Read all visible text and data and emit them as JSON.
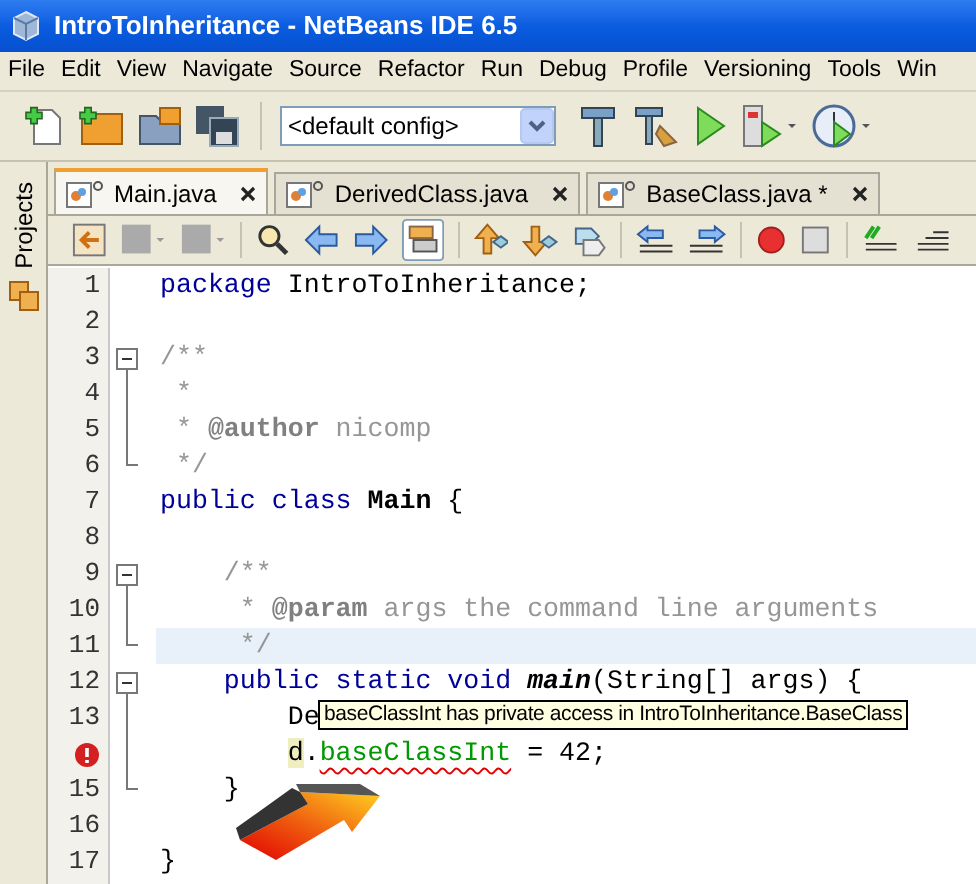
{
  "window": {
    "title": "IntroToInheritance - NetBeans IDE 6.5"
  },
  "menu": [
    "File",
    "Edit",
    "View",
    "Navigate",
    "Source",
    "Refactor",
    "Run",
    "Debug",
    "Profile",
    "Versioning",
    "Tools",
    "Win"
  ],
  "toolbar": {
    "config": "<default config>"
  },
  "sidebar": {
    "label": "Projects"
  },
  "tabs": [
    {
      "label": "Main.java",
      "selected": true
    },
    {
      "label": "DerivedClass.java",
      "selected": false
    },
    {
      "label": "BaseClass.java *",
      "selected": false
    }
  ],
  "editor": {
    "lines": [
      {
        "number": "1",
        "tokens": [
          {
            "text": "package",
            "kind": "keyword"
          },
          {
            "text": " IntroToInheritance;",
            "kind": "plain"
          }
        ]
      },
      {
        "number": "2"
      },
      {
        "number": "3",
        "fold_toggle": true,
        "tokens": [
          {
            "text": "/**",
            "kind": "comment"
          }
        ]
      },
      {
        "number": "4",
        "fold_line": true,
        "tokens": [
          {
            "text": " *",
            "kind": "comment"
          }
        ]
      },
      {
        "number": "5",
        "fold_line": true,
        "tokens": [
          {
            "text": " * ",
            "kind": "comment"
          },
          {
            "text": "@author",
            "kind": "doc-tag"
          },
          {
            "text": " nicomp",
            "kind": "comment"
          }
        ]
      },
      {
        "number": "6",
        "fold_end": true,
        "tokens": [
          {
            "text": " */",
            "kind": "comment"
          }
        ]
      },
      {
        "number": "7",
        "tokens": [
          {
            "text": "public",
            "kind": "keyword"
          },
          {
            "text": " class",
            "kind": "keyword"
          },
          {
            "text": " Main",
            "kind": "class-name"
          },
          {
            "text": " {",
            "kind": "plain"
          }
        ]
      },
      {
        "number": "8"
      },
      {
        "number": "9",
        "fold_toggle": true,
        "tokens": [
          {
            "text": "    /**",
            "kind": "comment"
          }
        ]
      },
      {
        "number": "10",
        "fold_line": true,
        "tokens": [
          {
            "text": "     * ",
            "kind": "comment"
          },
          {
            "text": "@param",
            "kind": "doc-tag"
          },
          {
            "text": " args the command line arguments",
            "kind": "comment"
          }
        ]
      },
      {
        "number": "11",
        "fold_end": true,
        "current": true,
        "tokens": [
          {
            "text": "     */",
            "kind": "comment"
          }
        ]
      },
      {
        "number": "12",
        "fold_toggle": true,
        "tokens": [
          {
            "text": "    public",
            "kind": "keyword"
          },
          {
            "text": " static",
            "kind": "keyword"
          },
          {
            "text": " void",
            "kind": "keyword"
          },
          {
            "text": " main",
            "kind": "method"
          },
          {
            "text": "(String[] args) {",
            "kind": "plain"
          }
        ]
      },
      {
        "number": "13",
        "fold_line": true,
        "tokens": [
          {
            "text": "        De",
            "kind": "plain"
          }
        ]
      },
      {
        "error": true,
        "fold_line": true,
        "tokens": [
          {
            "text": "        d",
            "kind": "plain",
            "highlighted": true
          },
          {
            "text": ".",
            "kind": "plain"
          },
          {
            "text": "baseClassInt",
            "kind": "field",
            "error": true
          },
          {
            "text": " = 42;",
            "kind": "plain"
          }
        ]
      },
      {
        "number": "15",
        "fold_end": true,
        "tokens": [
          {
            "text": "    }",
            "kind": "plain"
          }
        ]
      },
      {
        "number": "16"
      },
      {
        "number": "17",
        "tokens": [
          {
            "text": "}",
            "kind": "plain"
          }
        ]
      }
    ]
  },
  "tooltip": {
    "text": "baseClassInt has private access in IntroToInheritance.BaseClass"
  }
}
